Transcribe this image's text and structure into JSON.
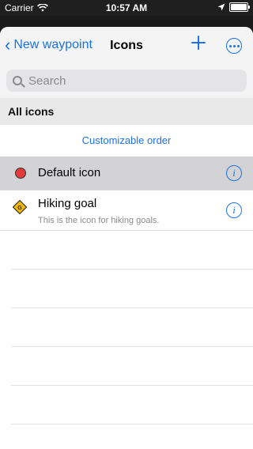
{
  "status_bar": {
    "carrier": "Carrier",
    "time": "10:57 AM",
    "battery_level": 1.0
  },
  "nav": {
    "back_label": "New waypoint",
    "title": "Icons",
    "add_icon": "plus-icon",
    "more_icon": "ellipsis-circle-icon"
  },
  "search": {
    "placeholder": "Search",
    "value": ""
  },
  "section": {
    "title": "All icons"
  },
  "customizable_order": "Customizable order",
  "rows": [
    {
      "label": "Default icon",
      "subtitle": "",
      "icon": "red-circle-icon",
      "selected": true,
      "info_glyph": "i"
    },
    {
      "label": "Hiking goal",
      "subtitle": "This is the icon for hiking goals.",
      "icon": "hiking-goal-icon",
      "selected": false,
      "info_glyph": "i"
    }
  ],
  "colors": {
    "accent": "#1a73e8",
    "selected_row": "#d3d3d6",
    "red_dot": "#e23b3b",
    "diamond": "#f2b705"
  }
}
